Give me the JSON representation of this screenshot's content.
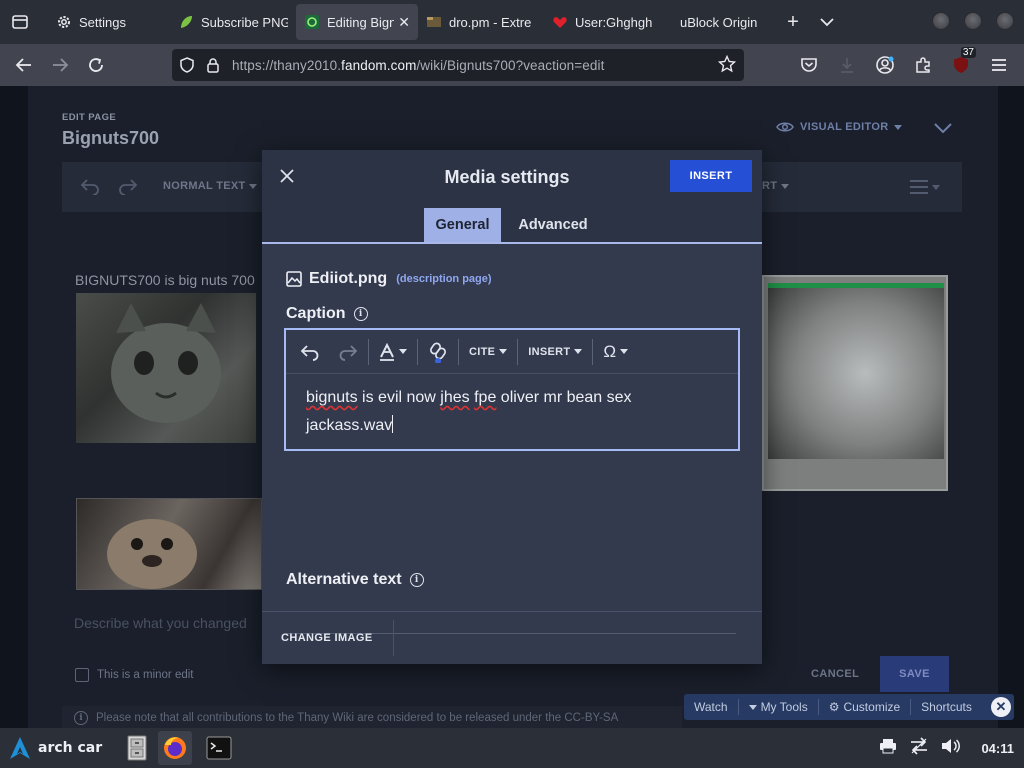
{
  "browser": {
    "tabs": [
      {
        "label": "Settings",
        "icon": "gear-icon",
        "active": false
      },
      {
        "label": "Subscribe PNG",
        "icon": "leaf-icon",
        "active": false
      },
      {
        "label": "Editing Bign",
        "icon": "fandom-icon",
        "active": true
      },
      {
        "label": "dro.pm - Extre",
        "icon": "folder-icon",
        "active": false
      },
      {
        "label": "User:Ghghgh",
        "icon": "heart-icon",
        "active": false
      },
      {
        "label": "uBlock Origin",
        "icon": "",
        "active": false
      }
    ],
    "url_prefix": "https://thany2010.",
    "url_domain": "fandom.com",
    "url_suffix": "/wiki/Bignuts700?veaction=edit",
    "extension_badge": "37"
  },
  "page": {
    "edit_label": "EDIT PAGE",
    "title": "Bignuts700",
    "visual_editor_toggle": "VISUAL EDITOR",
    "toolbar_normal_text": "NORMAL TEXT",
    "toolbar_partial": "RT",
    "content_text": "BIGNUTS700 is big nuts 700",
    "summary_placeholder": "Describe what you changed",
    "minor_edit_label": "This is a minor edit",
    "cancel_label": "CANCEL",
    "save_label": "SAVE",
    "license_text": "Please note that all contributions to the Thany Wiki are considered to be released under the CC-BY-SA"
  },
  "fandom_tools": {
    "watch": "Watch",
    "my_tools": "My Tools",
    "customize": "Customize",
    "shortcuts": "Shortcuts"
  },
  "dialog": {
    "title": "Media settings",
    "insert_label": "INSERT",
    "tabs": [
      "General",
      "Advanced"
    ],
    "file_name": "Ediiot.png",
    "description_link": "(description page)",
    "caption_label": "Caption",
    "caption_toolbar": {
      "cite": "CITE",
      "insert": "INSERT",
      "omega": "Ω"
    },
    "caption_text_line1": [
      "bignuts",
      " is evil now ",
      "jhes",
      " ",
      "fpe",
      " oliver mr bean sex"
    ],
    "caption_text_line2": "jackass.wav",
    "alt_text_label": "Alternative text",
    "alt_text_value": "",
    "change_image_label": "CHANGE IMAGE"
  },
  "taskbar": {
    "start_label": "arch car",
    "clock": "04:11"
  },
  "colors": {
    "accent_blue": "#2550d6",
    "tab_active_bg": "#9fb0e6",
    "dialog_bg": "#333a4d"
  }
}
